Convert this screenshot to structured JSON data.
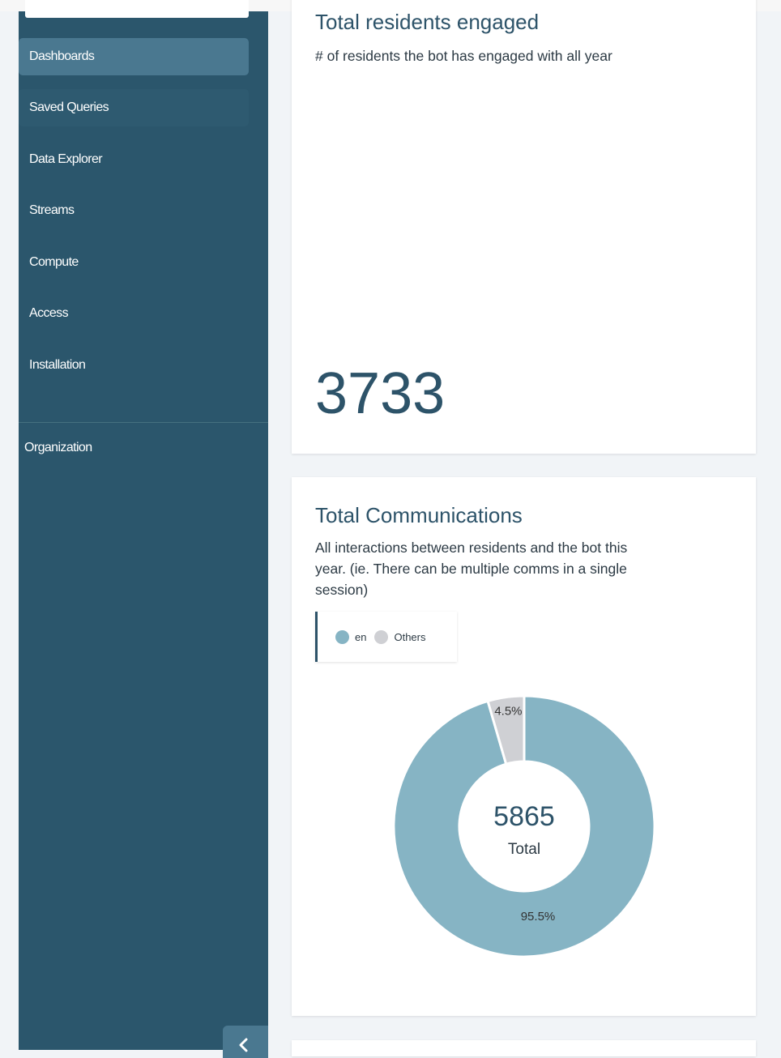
{
  "sidebar": {
    "items": [
      {
        "label": "Dashboards",
        "active": true
      },
      {
        "label": "Saved Queries",
        "active": false
      },
      {
        "label": "Data Explorer",
        "active": false
      },
      {
        "label": "Streams",
        "active": false
      },
      {
        "label": "Compute",
        "active": false
      },
      {
        "label": "Access",
        "active": false
      },
      {
        "label": "Installation",
        "active": false
      }
    ],
    "organization_label": "Organization",
    "collapse_icon": "chevron-left-icon"
  },
  "cards": {
    "residents": {
      "title": "Total residents engaged",
      "description": "# of residents the bot has engaged with all year",
      "value": "3733"
    },
    "communications": {
      "title": "Total Communications",
      "description_lines": [
        "All interactions between residents and the bot this",
        "year. (ie. There can be multiple comms in a single",
        "session)"
      ],
      "total_value": "5865",
      "total_label": "Total"
    }
  },
  "chart_data": {
    "type": "pie",
    "legend": [
      "en",
      "Others"
    ],
    "legend_placement": "top-left",
    "slices": [
      {
        "label": "en",
        "value": 95.5,
        "display": "95.5%",
        "color": "#86b4c4"
      },
      {
        "label": "Others",
        "value": 4.5,
        "display": "4.5%",
        "color": "#cfd0d4"
      }
    ],
    "center_value": "5865",
    "center_label": "Total"
  },
  "colors": {
    "sidebar_bg": "#2b566c",
    "sidebar_active": "#4a7890",
    "accent_text": "#2d5369",
    "page_bg": "#f1f4f7"
  }
}
